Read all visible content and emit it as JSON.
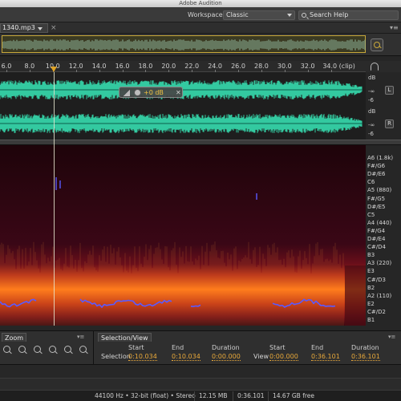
{
  "app": {
    "title": "Adobe Audition"
  },
  "workspace": {
    "label": "Workspace:",
    "value": "Classic"
  },
  "help": {
    "placeholder": "Search Help"
  },
  "file_tab": {
    "name": "1340.mp3",
    "close": "×"
  },
  "ruler": {
    "ticks": [
      "6.0",
      "8.0",
      "10.0",
      "12.0",
      "14.0",
      "16.0",
      "18.0",
      "20.0",
      "22.0",
      "24.0",
      "26.0",
      "28.0",
      "30.0",
      "32.0",
      "34.0 (clip)"
    ]
  },
  "waveform": {
    "scale_top": "dB",
    "scale_inf": "-∞",
    "scale_minus6": "-6",
    "left_label": "L",
    "right_label": "R",
    "hud_value": "+0 dB",
    "color": "#33c9a0"
  },
  "pitch_labels": [
    "A6 (1.8k)",
    "F#/G6",
    "D#/E6",
    "C6",
    "A5 (880)",
    "F#/G5",
    "D#/E5",
    "C5",
    "A4 (440)",
    "F#/G4",
    "D#/E4",
    "C#/D4",
    "B3",
    "A3 (220)",
    "E3",
    "C#/D3",
    "B2",
    "A2 (110)",
    "E2",
    "C#/D2",
    "B1"
  ],
  "zoom_panel": {
    "title": "Zoom",
    "menu": "▾≡"
  },
  "selection_view": {
    "title": "Selection/View",
    "headers": {
      "start": "Start",
      "end": "End",
      "duration": "Duration"
    },
    "selection": {
      "label": "Selection",
      "start": "0:10.034",
      "end": "0:10.034",
      "duration": "0:00.000"
    },
    "view": {
      "label": "View",
      "start": "0:00.000",
      "end": "0:36.101",
      "duration": "0:36.101"
    }
  },
  "status": {
    "format": "44100 Hz • 32-bit (float) • Stereo",
    "size": "12.15 MB",
    "duration": "0:36.101",
    "free": "14.67 GB free"
  },
  "colors": {
    "accent": "#e8a83a",
    "spectrum_hot": "#ff7a1a",
    "pitch_curve": "#5a5aff"
  }
}
